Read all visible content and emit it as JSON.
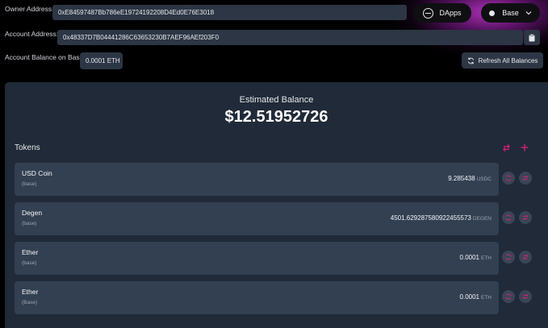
{
  "owner": {
    "label": "Owner Address:",
    "value": "0xE84597487Bb786eE19724192208D4Ed0E76E3018"
  },
  "account": {
    "label": "Account Address:",
    "value": "0x48337D7B04441286C63653230B7AEF96AEf203F0"
  },
  "balance_row": {
    "label": "Account Balance on Base:",
    "value": "0.0001 ETH",
    "refresh_label": "Refresh All Balances"
  },
  "dapps_label": "DApps",
  "network_label": "Base",
  "estimated": {
    "label": "Estimated Balance",
    "value": "$12.51952726"
  },
  "tokens_title": "Tokens",
  "tokens": [
    {
      "name": "USD Coin",
      "network": "(base)",
      "amount": "9.285438",
      "unit": "USDC"
    },
    {
      "name": "Degen",
      "network": "(base)",
      "amount": "4501.629287580922455573",
      "unit": "DEGEN"
    },
    {
      "name": "Ether",
      "network": "(base)",
      "amount": "0.0001",
      "unit": "ETH"
    },
    {
      "name": "Ether",
      "network": "(Base)",
      "amount": "0.0001",
      "unit": "ETH"
    }
  ],
  "colors": {
    "accent": "#e0217a",
    "panel": "#202a38",
    "row": "#334052",
    "field": "#2d3644"
  }
}
